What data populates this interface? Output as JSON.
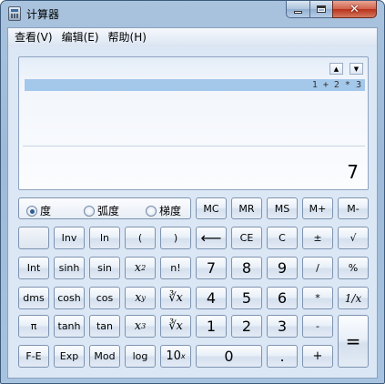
{
  "window": {
    "title": "计算器"
  },
  "menu": [
    "查看(V)",
    "编辑(E)",
    "帮助(H)"
  ],
  "display": {
    "history_up": "▲",
    "history_down": "▼",
    "expression": "1 + 2 * 3",
    "result": "7"
  },
  "angle_units": {
    "options": [
      "度",
      "弧度",
      "梯度"
    ],
    "selected": "度"
  },
  "keys": {
    "mc": "MC",
    "mr": "MR",
    "ms": "MS",
    "mplus": "M+",
    "mminus": "M-",
    "inv": "Inv",
    "ln": "ln",
    "lparen": "(",
    "rparen": ")",
    "backspace": "⟵",
    "ce": "CE",
    "c": "C",
    "plusminus": "±",
    "sqrt": "√",
    "int": "Int",
    "sinh": "sinh",
    "sin": "sin",
    "x2": "x",
    "x2_exp": "2",
    "nfact": "n!",
    "d7": "7",
    "d8": "8",
    "d9": "9",
    "div": "/",
    "pct": "%",
    "dms": "dms",
    "cosh": "cosh",
    "cos": "cos",
    "xy": "x",
    "xy_exp": "y",
    "yroot": "∛x",
    "d4": "4",
    "d5": "5",
    "d6": "6",
    "mul": "*",
    "recip": "1/x",
    "pi": "π",
    "tanh": "tanh",
    "tan": "tan",
    "x3": "x",
    "x3_exp": "3",
    "cbrt": "∛x",
    "d1": "1",
    "d2": "2",
    "d3": "3",
    "sub": "-",
    "eq": "=",
    "fe": "F-E",
    "exp": "Exp",
    "mod": "Mod",
    "log": "log",
    "tenx": "10",
    "tenx_exp": "x",
    "d0": "0",
    "dot": ".",
    "add": "+"
  }
}
